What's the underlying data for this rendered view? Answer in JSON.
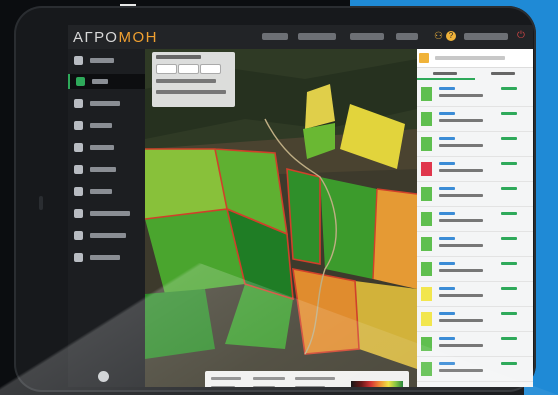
{
  "app": {
    "logo_main": "АГРО",
    "logo_accent": "МОН"
  },
  "icons": {
    "key": "key-icon",
    "help": "question-icon",
    "power": "power-icon",
    "zoom_in": "plus-icon",
    "zoom_out": "minus-icon",
    "fullscreen": "fullscreen-icon",
    "locate": "target-icon"
  },
  "topbar": {
    "key_glyph": "⚇",
    "help_glyph": "?",
    "power_glyph": "⏻"
  },
  "map_controls": {
    "zoom_in_glyph": "+",
    "zoom_out_glyph": "−",
    "fullscreen_glyph": "□",
    "locate_glyph": "◎"
  },
  "colors": {
    "accent_green": "#2ea95a",
    "accent_yellow": "#f0b33a",
    "link_blue": "#3b8cd6",
    "frame_blue": "#1f8ad6",
    "field_border_red": "#d0402a"
  },
  "field_list_swatches": [
    "#5fbf4f",
    "#5fbf4f",
    "#5fbf4f",
    "#e0364c",
    "#5fbf4f",
    "#5fbf4f",
    "#5fbf4f",
    "#5fbf4f",
    "#f2e64e",
    "#f2e64e",
    "#5fbf4f",
    "#5fbf4f",
    "#5fbf4f"
  ]
}
